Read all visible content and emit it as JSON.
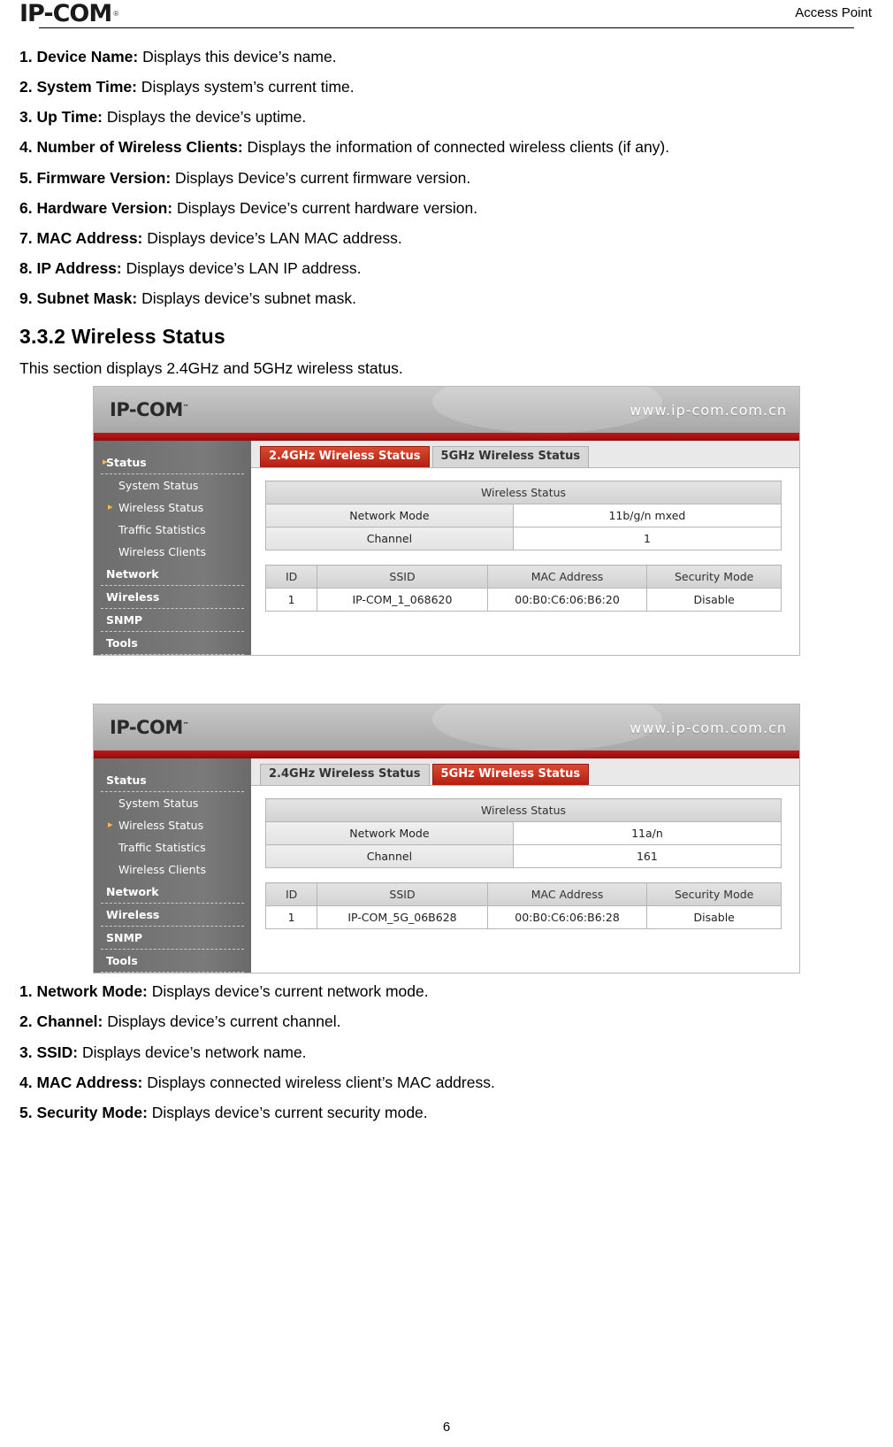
{
  "header": {
    "logo": "IP-COM",
    "logo_registered": "®",
    "right_title": "Access Point"
  },
  "body_items_top": [
    {
      "num": "1. Device Name:",
      "text": " Displays this device’s name."
    },
    {
      "num": "2. System Time:",
      "text": " Displays system’s current time."
    },
    {
      "num": "3. Up Time:",
      "text": " Displays the device’s uptime."
    },
    {
      "num": "4. Number of Wireless Clients:",
      "text": " Displays the information of connected wireless clients (if any)."
    },
    {
      "num": "5. Firmware Version:",
      "text": " Displays Device’s current firmware version."
    },
    {
      "num": "6. Hardware Version:",
      "text": " Displays Device’s current hardware version."
    },
    {
      "num": "7. MAC Address:",
      "text": " Displays device’s LAN MAC address."
    },
    {
      "num": "8. IP Address:",
      "text": " Displays device’s LAN IP address."
    },
    {
      "num": "9. Subnet Mask:",
      "text": " Displays device’s subnet mask."
    }
  ],
  "section": {
    "heading": "3.3.2 Wireless Status",
    "intro": "This section displays 2.4GHz and 5GHz wireless status."
  },
  "figure1": {
    "logo": "IP-COM",
    "logo_tm": "™",
    "url": "www.ip-com.com.cn",
    "tabs": [
      {
        "label": "2.4GHz Wireless Status",
        "active": true
      },
      {
        "label": "5GHz Wireless Status",
        "active": false
      }
    ],
    "sidebar": [
      {
        "label": "Status",
        "type": "group",
        "bullet": true
      },
      {
        "label": "System Status",
        "type": "sub",
        "bullet": false
      },
      {
        "label": "Wireless Status",
        "type": "sub",
        "bullet": true
      },
      {
        "label": "Traffic Statistics",
        "type": "sub",
        "bullet": false
      },
      {
        "label": "Wireless Clients",
        "type": "sub",
        "bullet": false
      },
      {
        "label": "Network",
        "type": "group",
        "bullet": false
      },
      {
        "label": "Wireless",
        "type": "group",
        "bullet": false
      },
      {
        "label": "SNMP",
        "type": "group",
        "bullet": false
      },
      {
        "label": "Tools",
        "type": "group",
        "bullet": false
      }
    ],
    "status_table": {
      "title": "Wireless Status",
      "rows": [
        {
          "label": "Network Mode",
          "value": "11b/g/n mxed"
        },
        {
          "label": "Channel",
          "value": "1"
        }
      ]
    },
    "client_table": {
      "headers": [
        "ID",
        "SSID",
        "MAC Address",
        "Security Mode"
      ],
      "rows": [
        [
          "1",
          "IP-COM_1_068620",
          "00:B0:C6:06:B6:20",
          "Disable"
        ]
      ]
    }
  },
  "figure2": {
    "logo": "IP-COM",
    "logo_tm": "™",
    "url": "www.ip-com.com.cn",
    "tabs": [
      {
        "label": "2.4GHz Wireless Status",
        "active": false
      },
      {
        "label": "5GHz Wireless Status",
        "active": true
      }
    ],
    "sidebar": [
      {
        "label": "Status",
        "type": "group",
        "bullet": false
      },
      {
        "label": "System Status",
        "type": "sub",
        "bullet": false
      },
      {
        "label": "Wireless Status",
        "type": "sub",
        "bullet": true
      },
      {
        "label": "Traffic Statistics",
        "type": "sub",
        "bullet": false
      },
      {
        "label": "Wireless Clients",
        "type": "sub",
        "bullet": false
      },
      {
        "label": "Network",
        "type": "group",
        "bullet": false
      },
      {
        "label": "Wireless",
        "type": "group",
        "bullet": false
      },
      {
        "label": "SNMP",
        "type": "group",
        "bullet": false
      },
      {
        "label": "Tools",
        "type": "group",
        "bullet": false
      }
    ],
    "status_table": {
      "title": "Wireless Status",
      "rows": [
        {
          "label": "Network Mode",
          "value": "11a/n"
        },
        {
          "label": "Channel",
          "value": "161"
        }
      ]
    },
    "client_table": {
      "headers": [
        "ID",
        "SSID",
        "MAC Address",
        "Security Mode"
      ],
      "rows": [
        [
          "1",
          "IP-COM_5G_06B628",
          "00:B0:C6:06:B6:28",
          "Disable"
        ]
      ]
    }
  },
  "body_items_bottom": [
    {
      "num": "1. Network Mode:",
      "text": " Displays device’s current network mode."
    },
    {
      "num": "2. Channel:",
      "text": " Displays device’s current channel."
    },
    {
      "num": "3. SSID:",
      "text": " Displays device’s network name."
    },
    {
      "num": "4. MAC Address:",
      "text": " Displays connected wireless client’s MAC address."
    },
    {
      "num": "5. Security Mode:",
      "text": " Displays device’s current security mode."
    }
  ],
  "footer": {
    "page_number": "6"
  }
}
